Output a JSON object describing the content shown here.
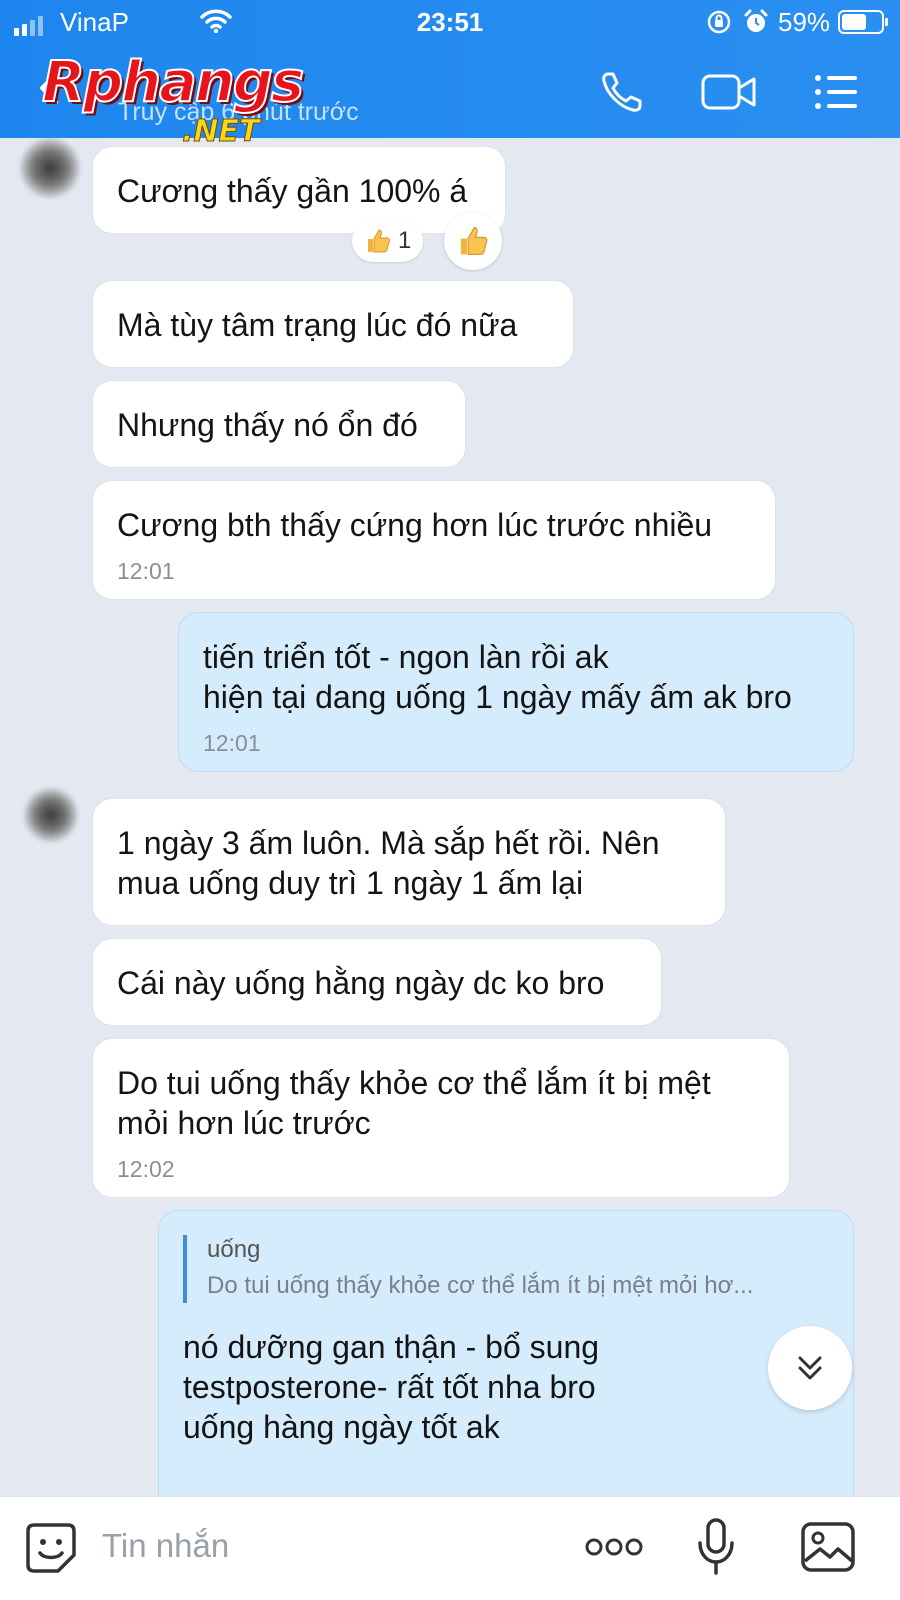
{
  "status_bar": {
    "carrier": "VinaP",
    "time": "23:51",
    "battery": "59%"
  },
  "header": {
    "watermark_main": "Rphangs",
    "watermark_sub": ".NET",
    "last_seen": "Truy cập 6 phút trước"
  },
  "messages": [
    {
      "side": "them",
      "text": "Cương thấy gần 100% á",
      "reaction_count": "1"
    },
    {
      "side": "them",
      "text": "Mà tùy tâm trạng lúc đó nữa"
    },
    {
      "side": "them",
      "text": "Nhưng thấy nó ổn đó"
    },
    {
      "side": "them",
      "text": "Cương bth thấy cứng hơn lúc trước nhiều",
      "time": "12:01"
    },
    {
      "side": "me",
      "text": "tiến triển tốt - ngon làn rồi ak\nhiện tại dang uống 1 ngày mấy ấm ak bro",
      "time": "12:01"
    },
    {
      "side": "them",
      "text": "1 ngày 3 ấm luôn. Mà sắp hết rồi. Nên\nmua uống duy trì 1 ngày 1 ấm lại"
    },
    {
      "side": "them",
      "text": "Cái này uống hằng ngày dc ko bro"
    },
    {
      "side": "them",
      "text": "Do tui uống thấy khỏe cơ thể lắm ít bị mệt\nmỏi hơn lúc trước",
      "time": "12:02"
    },
    {
      "side": "me",
      "quote_name": "uống",
      "quote_text": "Do tui uống thấy khỏe cơ thể lắm ít bị mệt mỏi hơ...",
      "text": "nó dưỡng gan thận - bổ sung\ntestposterone- rất tốt nha bro\nuống hàng ngày tốt ak"
    }
  ],
  "input": {
    "placeholder": "Tin nhắn"
  },
  "colors": {
    "header": "#1d86ee",
    "chat_bg": "#e4e8f1",
    "my_bubble": "#d5ecfc",
    "their_bubble": "#ffffff",
    "quote_bar": "#3e8ed6"
  },
  "icons": [
    "back-icon",
    "phone-icon",
    "video-call-icon",
    "menu-icon",
    "thumbs-up-icon",
    "scroll-down-icon",
    "sticker-icon",
    "more-icon",
    "microphone-icon",
    "image-icon"
  ]
}
